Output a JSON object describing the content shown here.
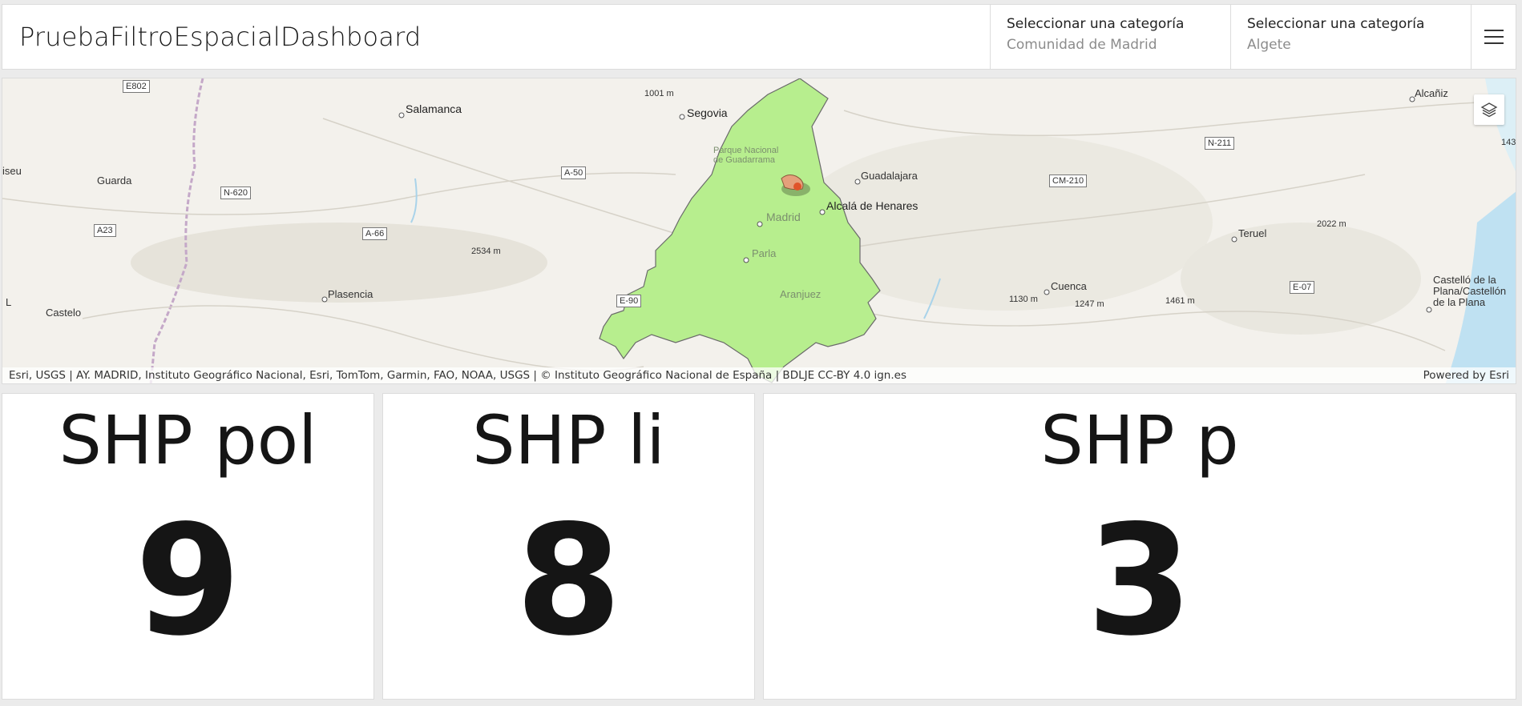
{
  "header": {
    "title": "PruebaFiltroEspacialDashboard",
    "selectors": [
      {
        "label": "Seleccionar una categoría",
        "value": "Comunidad de Madrid"
      },
      {
        "label": "Seleccionar una categoría",
        "value": "Algete"
      }
    ]
  },
  "map": {
    "labels": {
      "salamanca": "Salamanca",
      "segovia": "Segovia",
      "guadalajara": "Guadalajara",
      "alcala": "Alcalá de Henares",
      "madrid": "Madrid",
      "parla": "Parla",
      "aranjuez": "Aranjuez",
      "guarda": "Guarda",
      "viseu": "iseu",
      "plasencia": "Plasencia",
      "castelo": "Castelo",
      "cuenca": "Cuenca",
      "teruel": "Teruel",
      "alcaniz": "Alcañiz",
      "castellon1": "Castelló de la",
      "castellon2": "Plana/Castellón",
      "castellon3": "de la Plana",
      "guadarrama1": "Parque Nacional",
      "guadarrama2": "de Guadarrama",
      "elev1001": "1001 m",
      "elev2534": "2534 m",
      "elev1130": "1130 m",
      "elev1247": "1247 m",
      "elev1461": "1461 m",
      "elev2022": "2022 m",
      "edgeL": "L",
      "edge143": "143"
    },
    "shields": {
      "e802": "E802",
      "n620": "N-620",
      "a23": "A23",
      "a66": "A-66",
      "a50": "A-50",
      "e90": "E-90",
      "n211": "N-211",
      "cm210": "CM-210",
      "e07": "E-07"
    },
    "attribution": "Esri, USGS | AY. MADRID, Instituto Geográfico Nacional, Esri, TomTom, Garmin, FAO, NOAA, USGS | © Instituto Geográfico Nacional de España | BDLJE CC-BY 4.0 ign.es",
    "powered_by": "Powered by Esri",
    "colors": {
      "region_fill": "#b7ee8e",
      "region_stroke": "#6a6a6a",
      "feature": "#e0542a"
    }
  },
  "cards": [
    {
      "title": "SHP pol",
      "value": "9"
    },
    {
      "title": "SHP li",
      "value": "8"
    },
    {
      "title": "SHP p",
      "value": "3"
    }
  ]
}
